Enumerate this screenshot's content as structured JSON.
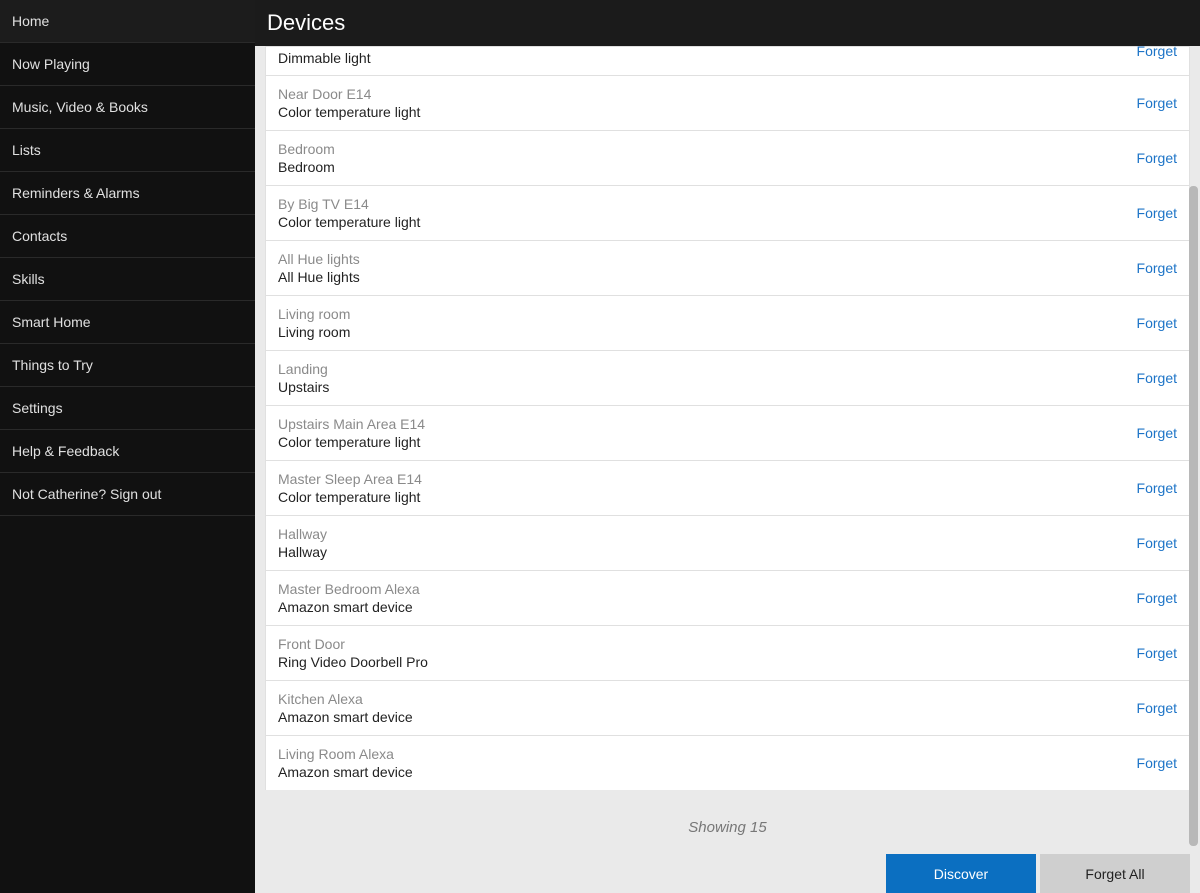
{
  "sidebar": {
    "items": [
      {
        "label": "Home"
      },
      {
        "label": "Now Playing"
      },
      {
        "label": "Music, Video & Books"
      },
      {
        "label": "Lists"
      },
      {
        "label": "Reminders & Alarms"
      },
      {
        "label": "Contacts"
      },
      {
        "label": "Skills"
      },
      {
        "label": "Smart Home"
      },
      {
        "label": "Things to Try"
      },
      {
        "label": "Settings"
      },
      {
        "label": "Help & Feedback"
      },
      {
        "label": "Not Catherine? Sign out"
      }
    ]
  },
  "header": {
    "title": "Devices"
  },
  "forget_label": "Forget",
  "devices": [
    {
      "name": "",
      "type": "Dimmable light"
    },
    {
      "name": "Near Door E14",
      "type": "Color temperature light"
    },
    {
      "name": "Bedroom",
      "type": "Bedroom"
    },
    {
      "name": "By Big TV E14",
      "type": "Color temperature light"
    },
    {
      "name": "All Hue lights",
      "type": "All Hue lights"
    },
    {
      "name": "Living room",
      "type": "Living room"
    },
    {
      "name": "Landing",
      "type": "Upstairs"
    },
    {
      "name": "Upstairs Main Area E14",
      "type": "Color temperature light"
    },
    {
      "name": "Master Sleep Area E14",
      "type": "Color temperature light"
    },
    {
      "name": "Hallway",
      "type": "Hallway"
    },
    {
      "name": "Master Bedroom Alexa",
      "type": "Amazon smart device"
    },
    {
      "name": "Front Door",
      "type": "Ring Video Doorbell Pro"
    },
    {
      "name": "Kitchen Alexa",
      "type": "Amazon smart device"
    },
    {
      "name": "Living Room Alexa",
      "type": "Amazon smart device"
    }
  ],
  "footer": {
    "showing": "Showing 15",
    "discover_label": "Discover",
    "forget_all_label": "Forget All"
  }
}
